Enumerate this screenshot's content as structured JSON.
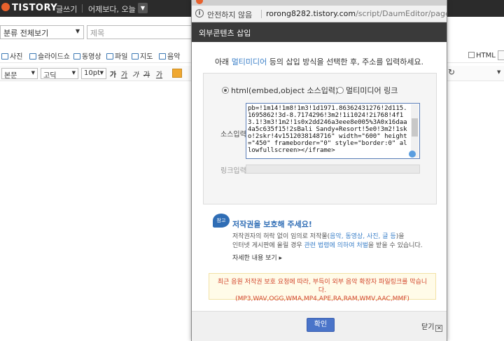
{
  "header": {
    "logo": "TISTORY",
    "mode": "글쓰기",
    "date_text": "어제보다, 오늘",
    "date_dropdown_icon": "chevron-down-icon"
  },
  "editor": {
    "category_select": "분류 전체보기",
    "title_placeholder": "제목",
    "attach_toolbar": [
      {
        "label": "사진",
        "icon": "image-icon"
      },
      {
        "label": "슬라이드쇼",
        "icon": "slideshow-icon"
      },
      {
        "label": "동영상",
        "icon": "video-icon"
      },
      {
        "label": "파일",
        "icon": "file-icon"
      },
      {
        "label": "지도",
        "icon": "map-icon"
      },
      {
        "label": "음악",
        "icon": "music-icon"
      }
    ],
    "html_checkbox": "HTML",
    "format": {
      "paragraph": "본문",
      "font": "고딕",
      "size": "10pt",
      "buttons": [
        "가",
        "가",
        "가",
        "가",
        "가"
      ]
    }
  },
  "popup": {
    "address": {
      "security_text": "안전하지 않음",
      "url_host": "rorong8282.tistory.com",
      "url_path": "/script/DaumEditor/pages..."
    },
    "title": "외부콘텐츠 삽입",
    "instruction_before": "아래 ",
    "instruction_highlight": "멀티미디어",
    "instruction_after": " 등의 삽입 방식을 선택한 후, 주소를 입력하세요.",
    "radio_html": "html(embed,object 소스입력)",
    "radio_link": "멀티미디어 링크",
    "source_label": "소스입력",
    "source_value": "pb=!1m14!1m8!1m3!1d1971.86362431276!2d115.1695862!3d-8.7174296!3m2!1i1024!2i768!4f13.1!3m3!1m2!1s0x2dd246a3eee8e005%3A0x16daa4a5c635f15!2sBali Sandy+Resort!5e0!3m2!1sko!2skr!4v1512038148716\" width=\"600\" height=\"450\" frameborder=\"0\" style=\"border:0\" allowfullscreen></iframe>",
    "link_label": "링크입력",
    "copyright_badge": "참고",
    "copyright_title": "저작권을 보호해 주세요!",
    "copyright_line1_a": "저작권자의 허락 없이 임의로 저작물(",
    "copyright_line1_hl": "음악, 동영상, 사진, 글 등",
    "copyright_line1_b": ")을",
    "copyright_line2_a": "인터넷 게시판에 올릴 경우 ",
    "copyright_line2_hl": "관련 법령에 의하여 처벌",
    "copyright_line2_b": "을 받을 수 있습니다.",
    "copyright_more": "자세한 내용 보기 ▸",
    "notice_line1": "최근 음원 저작권 보호 요청에 따라, 부득이 외부 음악 확장자 파일링크를 막습니다.",
    "notice_line2": "(MP3,WAV,OGG,WMA,MP4,APE,RA,RAM,WMV,AAC,MMF)",
    "ok_button": "확인",
    "close_button": "닫기"
  }
}
